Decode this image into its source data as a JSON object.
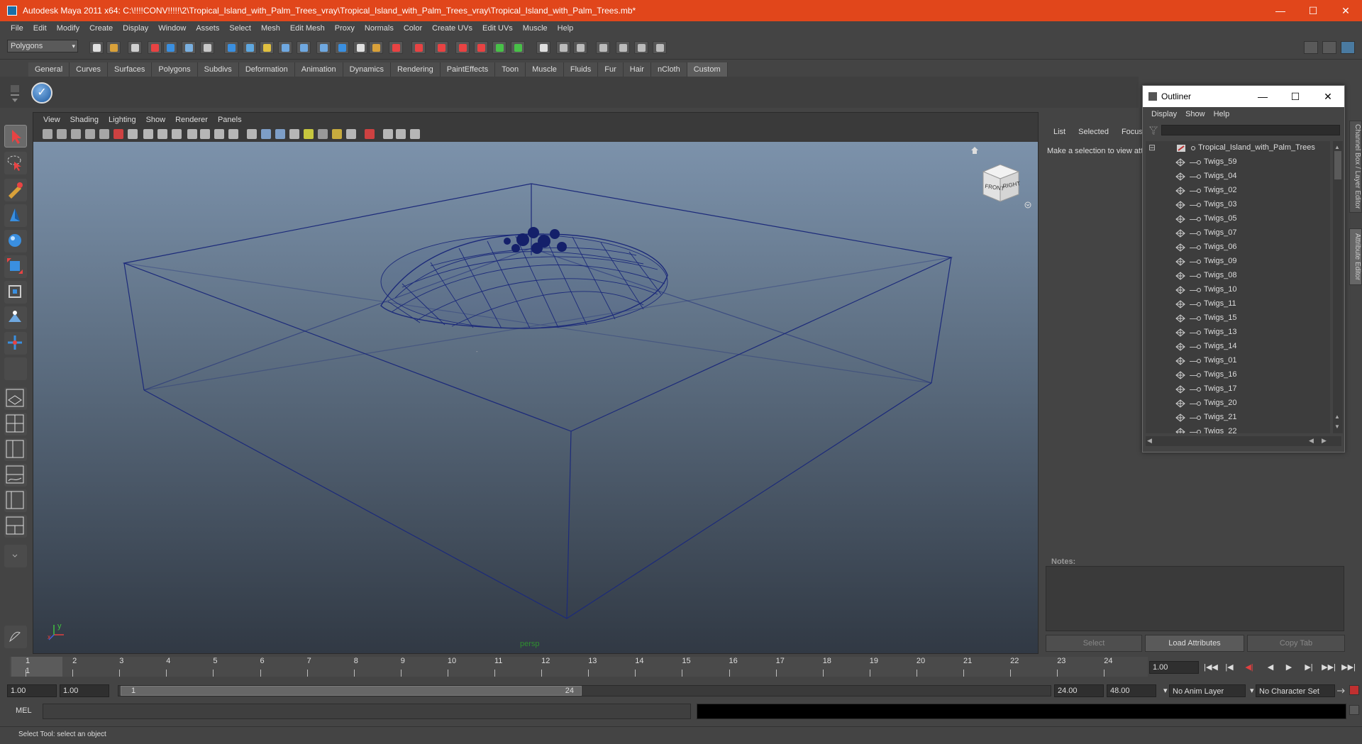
{
  "window": {
    "title": "Autodesk Maya 2011 x64: C:\\!!!!CONV!!!!!\\2\\Tropical_Island_with_Palm_Trees_vray\\Tropical_Island_with_Palm_Trees_vray\\Tropical_Island_with_Palm_Trees.mb*",
    "accent": "#e1461b",
    "min_icon": "—",
    "max_icon": "☐",
    "close_icon": "✕"
  },
  "menus": [
    "File",
    "Edit",
    "Modify",
    "Create",
    "Display",
    "Window",
    "Assets",
    "Select",
    "Mesh",
    "Edit Mesh",
    "Proxy",
    "Normals",
    "Color",
    "Create UVs",
    "Edit UVs",
    "Muscle",
    "Help"
  ],
  "mode_selector": {
    "value": "Polygons",
    "arrow": "▾"
  },
  "shelf_tabs": [
    "General",
    "Curves",
    "Surfaces",
    "Polygons",
    "Subdivs",
    "Deformation",
    "Animation",
    "Dynamics",
    "Rendering",
    "PaintEffects",
    "Toon",
    "Muscle",
    "Fluids",
    "Fur",
    "Hair",
    "nCloth",
    "Custom"
  ],
  "active_shelf_tab": "Custom",
  "shelf_button_glyph": "✓",
  "viewport": {
    "menus": [
      "View",
      "Shading",
      "Lighting",
      "Show",
      "Renderer",
      "Panels"
    ],
    "camera_label": "persp",
    "wire_color": "#1c2a7a",
    "viewcube": {
      "front": "FRONT",
      "right": "RIGHT"
    },
    "axis": {
      "x": "x",
      "y": "y"
    }
  },
  "attribute_editor": {
    "tabs": [
      "List",
      "Selected",
      "Focus"
    ],
    "message": "Make a selection to view att",
    "notes_label": "Notes:",
    "buttons": {
      "select": "Select",
      "load": "Load Attributes",
      "copy": "Copy Tab"
    },
    "side_tabs": {
      "channel": "Channel Box / Layer Editor",
      "attr": "Attribute Editor"
    }
  },
  "outliner": {
    "title": "Outliner",
    "menus": [
      "Display",
      "Show",
      "Help"
    ],
    "root": "Tropical_Island_with_Palm_Trees",
    "items": [
      "Twigs_59",
      "Twigs_04",
      "Twigs_02",
      "Twigs_03",
      "Twigs_05",
      "Twigs_07",
      "Twigs_06",
      "Twigs_09",
      "Twigs_08",
      "Twigs_10",
      "Twigs_11",
      "Twigs_15",
      "Twigs_13",
      "Twigs_14",
      "Twigs_01",
      "Twigs_16",
      "Twigs_17",
      "Twigs_20",
      "Twigs_21",
      "Twigs_22"
    ],
    "collapse_glyph": "⊟"
  },
  "timeline": {
    "ticks": [
      "1",
      "2",
      "3",
      "4",
      "5",
      "6",
      "7",
      "8",
      "9",
      "10",
      "11",
      "12",
      "13",
      "14",
      "15",
      "16",
      "17",
      "18",
      "19",
      "20",
      "21",
      "22",
      "23",
      "24"
    ],
    "current_frame": "1",
    "current_time": "1.00",
    "playback": [
      "|◀◀",
      "|◀",
      "◀|",
      "◀",
      "▶",
      "▶|",
      "▶▶|",
      "▶▶|"
    ]
  },
  "range": {
    "start": "1.00",
    "start_inner": "1.00",
    "thumb_start": "1",
    "thumb_end": "24",
    "end_inner": "24.00",
    "end": "48.00",
    "anim_layer": "No Anim Layer",
    "character_set": "No Character Set"
  },
  "command_line": {
    "label": "MEL"
  },
  "help_line": "Select Tool: select an object"
}
